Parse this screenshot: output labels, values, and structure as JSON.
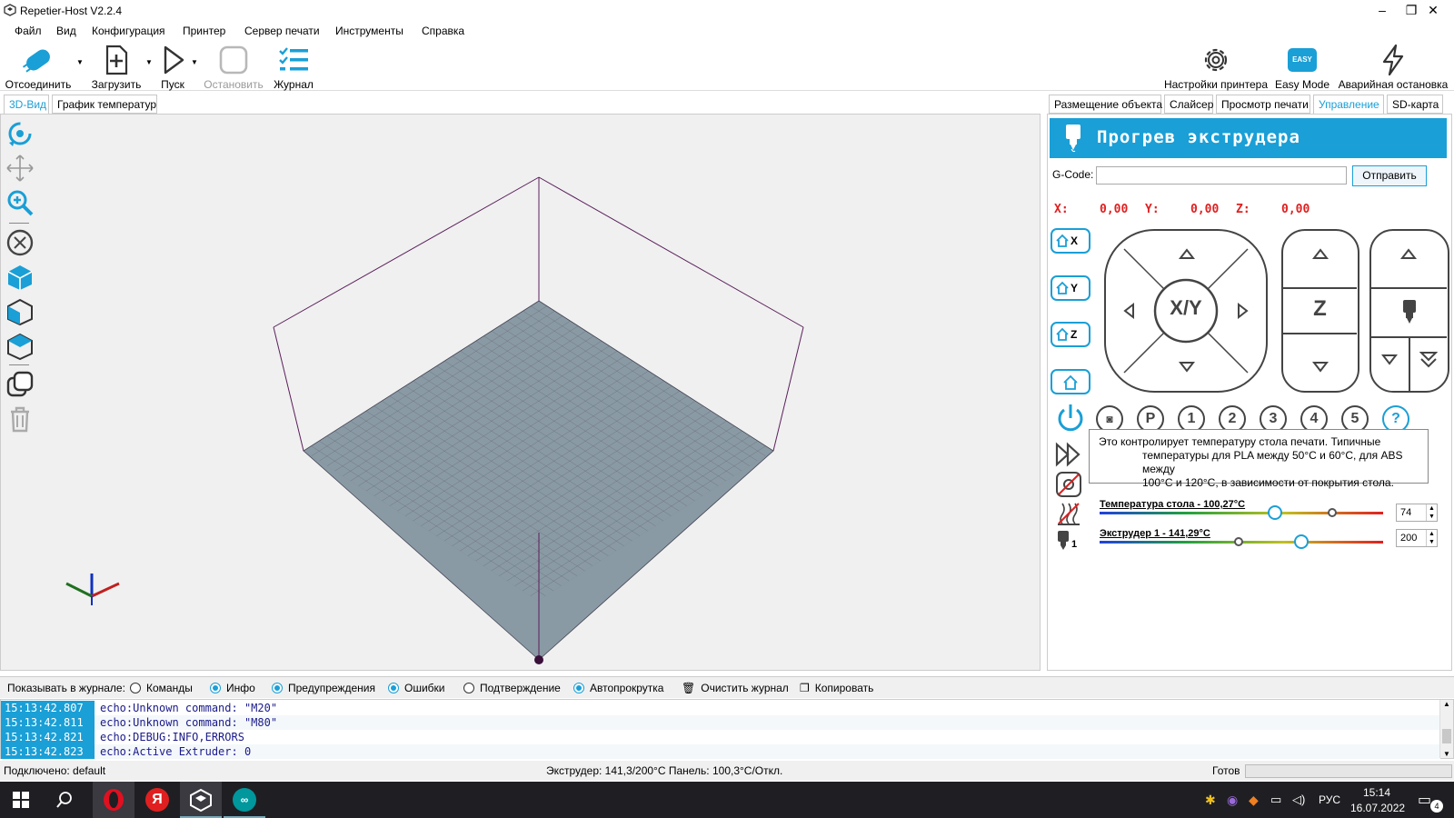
{
  "window": {
    "title": "Repetier-Host V2.2.4"
  },
  "menu": [
    "Файл",
    "Вид",
    "Конфигурация",
    "Принтер",
    "Сервер печати",
    "Инструменты",
    "Справка"
  ],
  "toolbar": {
    "disconnect": "Отсоединить",
    "load": "Загрузить",
    "run": "Пуск",
    "stop": "Остановить",
    "log": "Журнал",
    "printer_settings": "Настройки принтера",
    "easy_badge": "EASY",
    "easy_mode": "Easy Mode",
    "emergency": "Аварийная остановка"
  },
  "left_tabs": [
    "3D-Вид",
    "График температур"
  ],
  "right_tabs": [
    "Размещение объекта",
    "Слайсер",
    "Просмотр печати",
    "Управление",
    "SD-карта"
  ],
  "control": {
    "header": "Прогрев экструдера",
    "gcode_label": "G-Code:",
    "gcode_value": "",
    "send": "Отправить",
    "x_label": "X:",
    "x_value": "0,00",
    "y_label": "Y:",
    "y_value": "0,00",
    "z_label": "Z:",
    "z_value": "0,00",
    "home_x": "X",
    "home_y": "Y",
    "home_z": "Z",
    "xy_label": "X/Y",
    "z_label_big": "Z",
    "presets": [
      "P",
      "1",
      "2",
      "3",
      "4",
      "5",
      "?"
    ],
    "tooltip_line1": "Это контролирует температуру стола печати. Типичные",
    "tooltip_line2": "температуры для PLA между 50°C и 60°C, для ABS между",
    "tooltip_line3": "100°C и 120°C, в зависимости от покрытия стола.",
    "bed_label": "Температура стола - 100,27°C",
    "bed_target": "74",
    "extruder_label": "Экструдер 1 - 141,29°C",
    "extruder_target": "200",
    "extruder_index": "1",
    "bed_current_frac": 0.62,
    "bed_set_frac": 0.82,
    "ext_current_frac": 0.49,
    "ext_set_frac": 0.71
  },
  "log_options": {
    "show_label": "Показывать в журнале:",
    "commands": "Команды",
    "info": "Инфо",
    "warnings": "Предупреждения",
    "errors": "Ошибки",
    "ack": "Подтверждение",
    "autoscroll": "Автопрокрутка",
    "clear": "Очистить журнал",
    "copy": "Копировать"
  },
  "log": [
    {
      "time": "15:13:42.807",
      "msg": "echo:Unknown command: \"M20\""
    },
    {
      "time": "15:13:42.811",
      "msg": "echo:Unknown command: \"M80\""
    },
    {
      "time": "15:13:42.821",
      "msg": "echo:DEBUG:INFO,ERRORS"
    },
    {
      "time": "15:13:42.823",
      "msg": "echo:Active Extruder: 0"
    }
  ],
  "status": {
    "connected": "Подключено: default",
    "temps": "Экструдер: 141,3/200°C Панель: 100,3°C/Откл.",
    "ready": "Готов"
  },
  "taskbar": {
    "yandex": "Я",
    "lang": "РУС",
    "time": "15:14",
    "date": "16.07.2022",
    "notif_count": "4"
  },
  "colors": {
    "accent": "#1a9fd6",
    "coords": "#e02020",
    "bed": "#8a9aa4",
    "frame": "#5a1f5a"
  }
}
